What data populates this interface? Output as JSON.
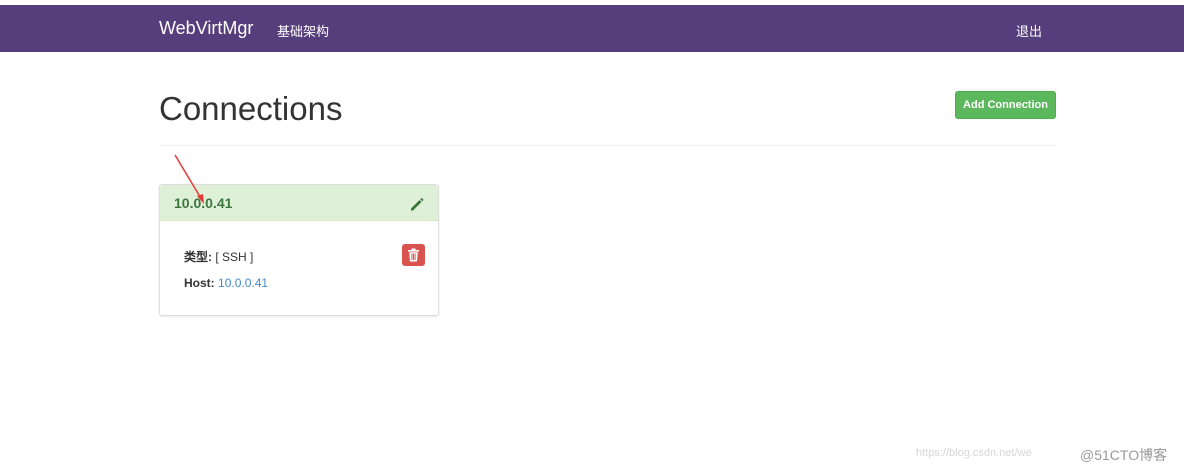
{
  "navbar": {
    "brand": "WebVirtMgr",
    "nav_link": "基础架构",
    "logout": "退出",
    "bg_color": "#563d7c"
  },
  "page": {
    "title": "Connections",
    "add_button": "Add Connection"
  },
  "connections": [
    {
      "name": "10.0.0.41",
      "type_label": "类型:",
      "type_value": "[ SSH ]",
      "host_label": "Host:",
      "host_value": "10.0.0.41"
    }
  ],
  "watermark": {
    "url_text": "https://blog.csdn.net/we",
    "brand": "@51CTO博客"
  },
  "colors": {
    "success": "#5cb85c",
    "danger": "#d9534f",
    "header_green": "#dff0d8",
    "link": "#428bca"
  }
}
